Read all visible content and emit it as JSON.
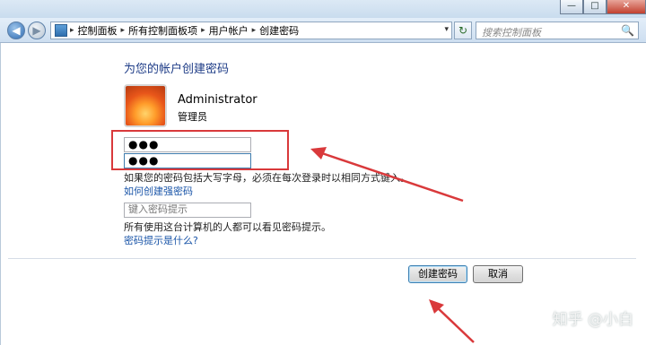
{
  "window": {
    "minimize_glyph": "—",
    "maximize_glyph": "□",
    "close_glyph": "✕"
  },
  "nav": {
    "back_glyph": "◀",
    "forward_glyph": "▶",
    "breadcrumbs": [
      "控制面板",
      "所有控制面板项",
      "用户帐户",
      "创建密码"
    ],
    "separator": "▸",
    "dropdown_glyph": "▾",
    "refresh_glyph": "↻",
    "search_placeholder": "搜索控制面板",
    "search_icon": "🔍"
  },
  "content": {
    "title": "为您的帐户创建密码",
    "user_name": "Administrator",
    "user_role": "管理员",
    "password_value": "●●●",
    "confirm_value": "●●●",
    "caps_note": "如果您的密码包括大写字母，必须在每次登录时以相同方式键入。",
    "strong_password_link": "如何创建强密码",
    "hint_placeholder": "键入密码提示",
    "hint_note": "所有使用这台计算机的人都可以看见密码提示。",
    "hint_link": "密码提示是什么?"
  },
  "buttons": {
    "create": "创建密码",
    "cancel": "取消"
  },
  "watermark": "知乎 @小白",
  "colors": {
    "annotation_red": "#d9393b",
    "link_blue": "#1a55a8",
    "title_blue": "#1e3c87"
  }
}
